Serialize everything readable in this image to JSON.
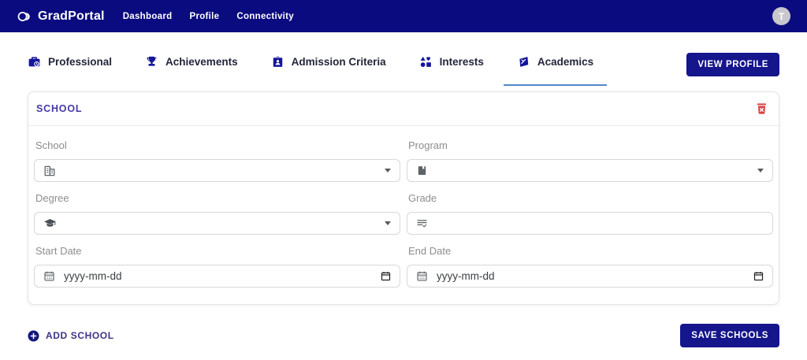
{
  "navbar": {
    "brand": "GradPortal",
    "links": [
      {
        "label": "Dashboard"
      },
      {
        "label": "Profile"
      },
      {
        "label": "Connectivity"
      }
    ],
    "avatar_initial": "T"
  },
  "tabs": [
    {
      "label": "Professional",
      "icon": "briefcase-clock-icon",
      "active": false
    },
    {
      "label": "Achievements",
      "icon": "trophy-icon",
      "active": false
    },
    {
      "label": "Admission Criteria",
      "icon": "id-badge-icon",
      "active": false
    },
    {
      "label": "Interests",
      "icon": "shapes-icon",
      "active": false
    },
    {
      "label": "Academics",
      "icon": "school-icon",
      "active": true
    }
  ],
  "view_profile_label": "VIEW PROFILE",
  "card": {
    "title": "SCHOOL",
    "delete_icon": "trash-icon",
    "fields": {
      "school": {
        "label": "School",
        "type": "select",
        "icon": "building-icon",
        "value": ""
      },
      "program": {
        "label": "Program",
        "type": "select",
        "icon": "book-icon",
        "value": ""
      },
      "degree": {
        "label": "Degree",
        "type": "select",
        "icon": "graduation-cap-icon",
        "value": ""
      },
      "grade": {
        "label": "Grade",
        "type": "text",
        "icon": "list-check-icon",
        "value": "",
        "placeholder": ""
      },
      "start_date": {
        "label": "Start Date",
        "type": "date",
        "icon": "calendar-icon",
        "value": "",
        "placeholder": "yyyy-mm-dd"
      },
      "end_date": {
        "label": "End Date",
        "type": "date",
        "icon": "calendar-icon",
        "value": "",
        "placeholder": "yyyy-mm-dd"
      }
    }
  },
  "actions": {
    "add_school_label": "ADD SCHOOL",
    "save_schools_label": "SAVE SCHOOLS"
  },
  "colors": {
    "navbar": "#0b0b80",
    "button": "#15158c",
    "active_tab_underline": "#5187c8",
    "card_title": "#4338a8",
    "danger": "#d64541",
    "label_gray": "#8d8d8d"
  }
}
